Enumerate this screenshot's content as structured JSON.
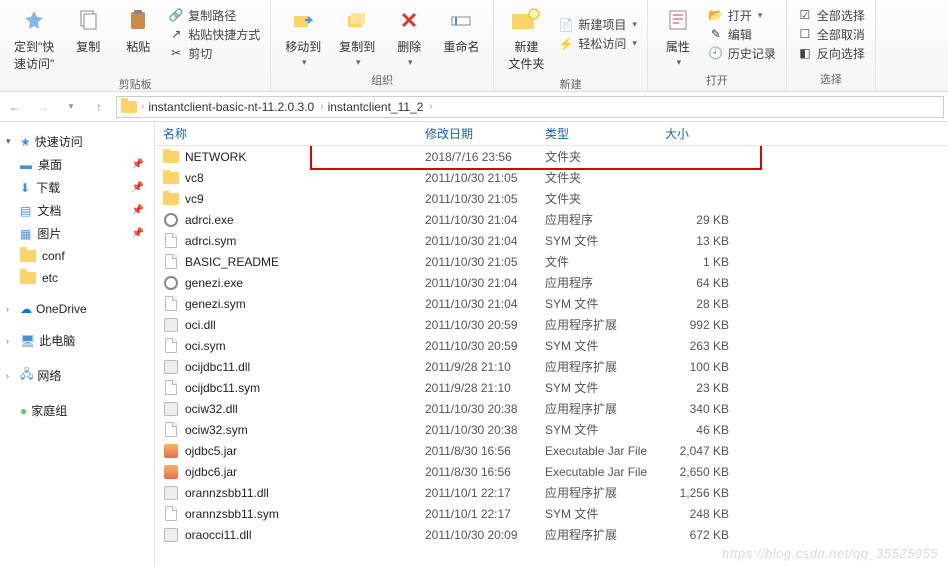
{
  "ribbon": {
    "clipboard": {
      "pin_label": "定到\"快\n速访问\"",
      "copy_label": "复制",
      "paste_label": "粘贴",
      "copy_path": "复制路径",
      "paste_shortcut": "粘贴快捷方式",
      "cut": "剪切",
      "group_label": "剪贴板"
    },
    "organize": {
      "move_to": "移动到",
      "copy_to": "复制到",
      "delete": "删除",
      "rename": "重命名",
      "group_label": "组织"
    },
    "new": {
      "new_folder": "新建\n文件夹",
      "new_item": "新建项目",
      "easy_access": "轻松访问",
      "group_label": "新建"
    },
    "open": {
      "properties": "属性",
      "open": "打开",
      "edit": "编辑",
      "history": "历史记录",
      "group_label": "打开"
    },
    "select": {
      "select_all": "全部选择",
      "select_none": "全部取消",
      "invert": "反向选择",
      "group_label": "选择"
    }
  },
  "breadcrumb": {
    "items": [
      "instantclient-basic-nt-11.2.0.3.0",
      "instantclient_11_2"
    ]
  },
  "sidebar": {
    "quick_access": "快速访问",
    "desktop": "桌面",
    "downloads": "下载",
    "documents": "文档",
    "pictures": "图片",
    "conf": "conf",
    "etc": "etc",
    "onedrive": "OneDrive",
    "this_pc": "此电脑",
    "network": "网络",
    "homegroup": "家庭组"
  },
  "columns": {
    "name": "名称",
    "date": "修改日期",
    "type": "类型",
    "size": "大小"
  },
  "files": [
    {
      "icon": "folder",
      "name": "NETWORK",
      "date": "2018/7/16 23:56",
      "type": "文件夹",
      "size": "",
      "hl": true
    },
    {
      "icon": "folder",
      "name": "vc8",
      "date": "2011/10/30 21:05",
      "type": "文件夹",
      "size": ""
    },
    {
      "icon": "folder",
      "name": "vc9",
      "date": "2011/10/30 21:05",
      "type": "文件夹",
      "size": ""
    },
    {
      "icon": "exe",
      "name": "adrci.exe",
      "date": "2011/10/30 21:04",
      "type": "应用程序",
      "size": "29 KB"
    },
    {
      "icon": "file",
      "name": "adrci.sym",
      "date": "2011/10/30 21:04",
      "type": "SYM 文件",
      "size": "13 KB"
    },
    {
      "icon": "file",
      "name": "BASIC_README",
      "date": "2011/10/30 21:05",
      "type": "文件",
      "size": "1 KB"
    },
    {
      "icon": "exe",
      "name": "genezi.exe",
      "date": "2011/10/30 21:04",
      "type": "应用程序",
      "size": "64 KB"
    },
    {
      "icon": "file",
      "name": "genezi.sym",
      "date": "2011/10/30 21:04",
      "type": "SYM 文件",
      "size": "28 KB"
    },
    {
      "icon": "dll",
      "name": "oci.dll",
      "date": "2011/10/30 20:59",
      "type": "应用程序扩展",
      "size": "992 KB"
    },
    {
      "icon": "file",
      "name": "oci.sym",
      "date": "2011/10/30 20:59",
      "type": "SYM 文件",
      "size": "263 KB"
    },
    {
      "icon": "dll",
      "name": "ocijdbc11.dll",
      "date": "2011/9/28 21:10",
      "type": "应用程序扩展",
      "size": "100 KB"
    },
    {
      "icon": "file",
      "name": "ocijdbc11.sym",
      "date": "2011/9/28 21:10",
      "type": "SYM 文件",
      "size": "23 KB"
    },
    {
      "icon": "dll",
      "name": "ociw32.dll",
      "date": "2011/10/30 20:38",
      "type": "应用程序扩展",
      "size": "340 KB"
    },
    {
      "icon": "file",
      "name": "ociw32.sym",
      "date": "2011/10/30 20:38",
      "type": "SYM 文件",
      "size": "46 KB"
    },
    {
      "icon": "jar",
      "name": "ojdbc5.jar",
      "date": "2011/8/30 16:56",
      "type": "Executable Jar File",
      "size": "2,047 KB"
    },
    {
      "icon": "jar",
      "name": "ojdbc6.jar",
      "date": "2011/8/30 16:56",
      "type": "Executable Jar File",
      "size": "2,650 KB"
    },
    {
      "icon": "dll",
      "name": "orannzsbb11.dll",
      "date": "2011/10/1 22:17",
      "type": "应用程序扩展",
      "size": "1,256 KB"
    },
    {
      "icon": "file",
      "name": "orannzsbb11.sym",
      "date": "2011/10/1 22:17",
      "type": "SYM 文件",
      "size": "248 KB"
    },
    {
      "icon": "dll",
      "name": "oraocci11.dll",
      "date": "2011/10/30 20:09",
      "type": "应用程序扩展",
      "size": "672 KB"
    }
  ],
  "watermark": "https://blog.csdn.net/qq_35525955"
}
